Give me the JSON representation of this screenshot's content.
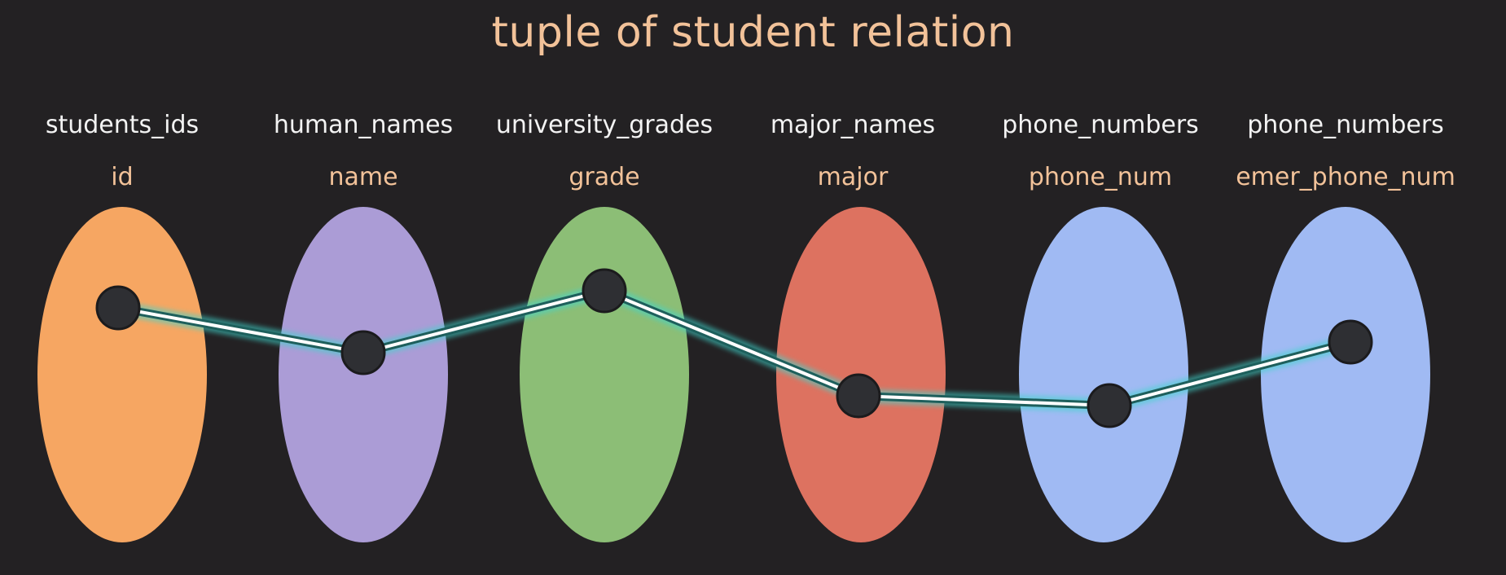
{
  "title": "tuple of student relation",
  "columns": [
    {
      "domain": "students_ids",
      "attribute": "id",
      "color": "#f6a662"
    },
    {
      "domain": "human_names",
      "attribute": "name",
      "color": "#ab9cd6"
    },
    {
      "domain": "university_grades",
      "attribute": "grade",
      "color": "#8cbe76"
    },
    {
      "domain": "major_names",
      "attribute": "major",
      "color": "#dd7260"
    },
    {
      "domain": "phone_numbers",
      "attribute": "phone_num",
      "color": "#a0baf3"
    },
    {
      "domain": "phone_numbers",
      "attribute": "emer_phone_num",
      "color": "#a0baf3"
    }
  ],
  "colors": {
    "background": "#232123",
    "title": "#f2c299",
    "domain_label": "#f3f3f3",
    "attribute_label": "#f2c299",
    "node": "#2e2f33",
    "tuple_line": "#ffffff",
    "tuple_glow": "#3fd6cc"
  }
}
